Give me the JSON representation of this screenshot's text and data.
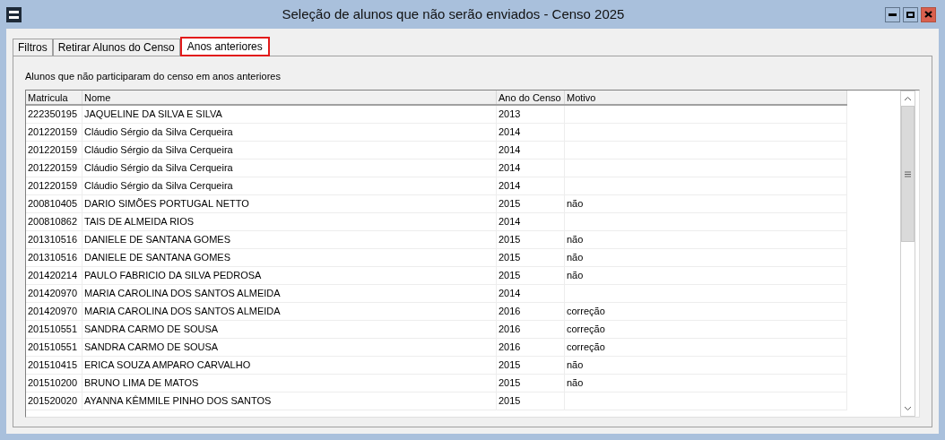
{
  "window": {
    "title": "Seleção de alunos que não serão enviados - Censo 2025"
  },
  "tabs": [
    {
      "label": "Filtros",
      "selected": false
    },
    {
      "label": "Retirar Alunos do Censo",
      "selected": false
    },
    {
      "label": "Anos anteriores",
      "selected": true
    }
  ],
  "panel": {
    "caption": "Alunos que não participaram do censo em anos anteriores"
  },
  "table": {
    "columns": [
      "Matricula",
      "Nome",
      "Ano do Censo",
      "Motivo"
    ],
    "rows": [
      [
        "222350195",
        "JAQUELINE DA SILVA E SILVA",
        "2013",
        ""
      ],
      [
        "201220159",
        "Cláudio Sérgio da Silva Cerqueira",
        "2014",
        ""
      ],
      [
        "201220159",
        "Cláudio Sérgio da Silva Cerqueira",
        "2014",
        ""
      ],
      [
        "201220159",
        "Cláudio Sérgio da Silva Cerqueira",
        "2014",
        ""
      ],
      [
        "201220159",
        "Cláudio Sérgio da Silva Cerqueira",
        "2014",
        ""
      ],
      [
        "200810405",
        "DARIO SIMÕES PORTUGAL NETTO",
        "2015",
        "não"
      ],
      [
        "200810862",
        "TAIS DE ALMEIDA RIOS",
        "2014",
        ""
      ],
      [
        "201310516",
        "DANIELE DE SANTANA GOMES",
        "2015",
        "não"
      ],
      [
        "201310516",
        "DANIELE DE SANTANA GOMES",
        "2015",
        "não"
      ],
      [
        "201420214",
        "PAULO FABRICIO DA SILVA PEDROSA",
        "2015",
        "não"
      ],
      [
        "201420970",
        "MARIA CAROLINA DOS SANTOS ALMEIDA",
        "2014",
        ""
      ],
      [
        "201420970",
        "MARIA CAROLINA DOS SANTOS ALMEIDA",
        "2016",
        "correção"
      ],
      [
        "201510551",
        "SANDRA CARMO DE SOUSA",
        "2016",
        "correção"
      ],
      [
        "201510551",
        "SANDRA CARMO DE SOUSA",
        "2016",
        "correção"
      ],
      [
        "201510415",
        "ERICA SOUZA AMPARO CARVALHO",
        "2015",
        "não"
      ],
      [
        "201510200",
        "BRUNO LIMA DE MATOS",
        "2015",
        "não"
      ],
      [
        "201520020",
        "AYANNA KÊMMILE PINHO DOS SANTOS",
        "2015",
        ""
      ]
    ]
  }
}
